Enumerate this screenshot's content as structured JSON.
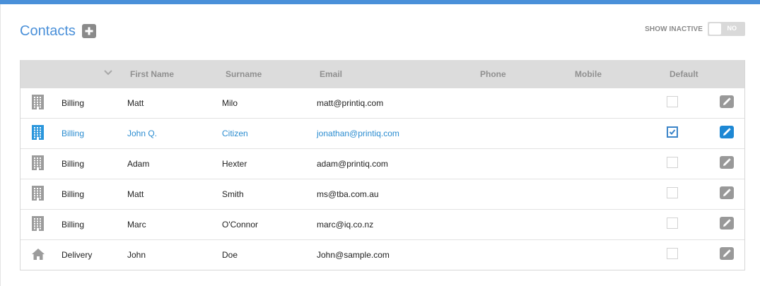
{
  "header": {
    "title": "Contacts",
    "add_icon": "plus-icon"
  },
  "show_inactive": {
    "label": "SHOW INACTIVE",
    "toggle_text": "NO",
    "value": false
  },
  "table": {
    "columns": {
      "first_name": "First Name",
      "surname": "Surname",
      "email": "Email",
      "phone": "Phone",
      "mobile": "Mobile",
      "default": "Default"
    },
    "rows": [
      {
        "icon": "building-icon",
        "type": "Billing",
        "first": "Matt",
        "surname": "Milo",
        "email": "matt@printiq.com",
        "phone": "",
        "mobile": "",
        "default": false,
        "highlighted": false
      },
      {
        "icon": "building-icon",
        "type": "Billing",
        "first": "John Q.",
        "surname": "Citizen",
        "email": "jonathan@printiq.com",
        "phone": "",
        "mobile": "",
        "default": true,
        "highlighted": true
      },
      {
        "icon": "building-icon",
        "type": "Billing",
        "first": "Adam",
        "surname": "Hexter",
        "email": "adam@printiq.com",
        "phone": "",
        "mobile": "",
        "default": false,
        "highlighted": false
      },
      {
        "icon": "building-icon",
        "type": "Billing",
        "first": "Matt",
        "surname": "Smith",
        "email": "ms@tba.com.au",
        "phone": "",
        "mobile": "",
        "default": false,
        "highlighted": false
      },
      {
        "icon": "building-icon",
        "type": "Billing",
        "first": "Marc",
        "surname": "O'Connor",
        "email": "marc@iq.co.nz",
        "phone": "",
        "mobile": "",
        "default": false,
        "highlighted": false
      },
      {
        "icon": "home-icon",
        "type": "Delivery",
        "first": "John",
        "surname": "Doe",
        "email": "John@sample.com",
        "phone": "",
        "mobile": "",
        "default": false,
        "highlighted": false
      }
    ]
  },
  "colors": {
    "accent": "#4a90d9",
    "highlight_text": "#2a8cd0",
    "edit_active": "#1e88d4",
    "edit_inactive": "#999999",
    "header_bg": "#dcdcdc"
  }
}
